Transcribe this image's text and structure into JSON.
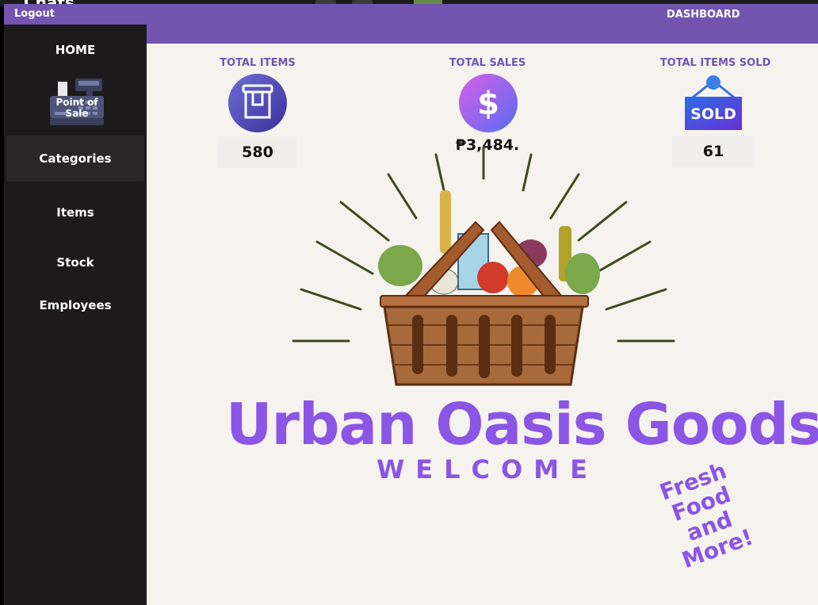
{
  "background_window": {
    "title": "Chats"
  },
  "topbar": {
    "logout_label": "Logout",
    "title": "DASHBOARD"
  },
  "sidebar": {
    "home": "HOME",
    "pos_label": "Point of Sale",
    "items": [
      {
        "label": "Categories"
      },
      {
        "label": "Items"
      },
      {
        "label": "Stock"
      },
      {
        "label": "Employees"
      }
    ]
  },
  "stats": {
    "total_items": {
      "label": "TOTAL ITEMS",
      "value": "580",
      "icon": "box-icon"
    },
    "total_sales": {
      "label": "TOTAL SALES",
      "value": "₱3,484.",
      "icon": "dollar-icon"
    },
    "total_items_sold": {
      "label": "TOTAL ITEMS SOLD",
      "value": "61",
      "icon": "sold-tag-icon",
      "tag_text": "SOLD"
    }
  },
  "hero": {
    "brand": "Urban Oasis Goods",
    "welcome": "WELCOME",
    "tagline": [
      "Fresh Food",
      "and",
      "More!"
    ]
  },
  "colors": {
    "accent": "#7354b0",
    "brand": "#8b55e6",
    "sidebar": "#1c1a1b",
    "canvas": "#f6f3ef"
  }
}
